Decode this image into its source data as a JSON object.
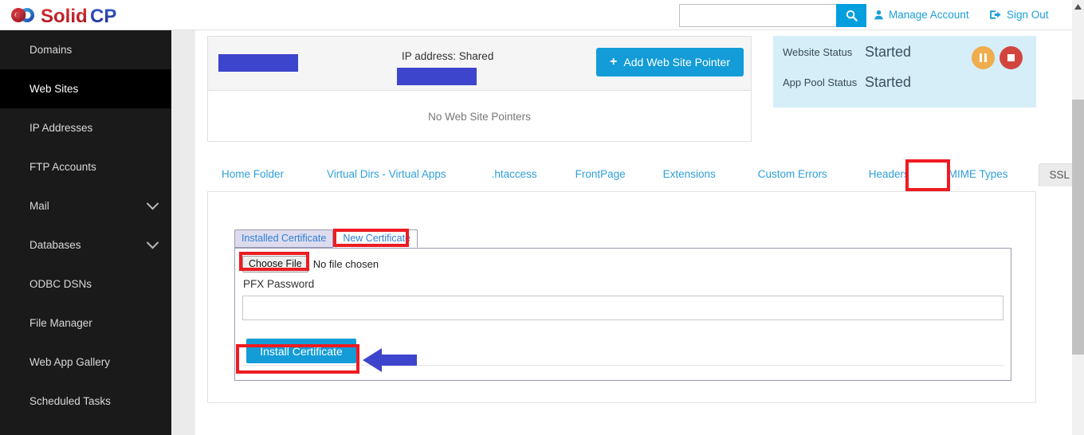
{
  "brand": {
    "name_part1": "Solid",
    "name_part2": "CP",
    "logo_icon": "solidcp-logo-icon",
    "color_red": "#c3161c",
    "color_blue": "#2b3bb5"
  },
  "header": {
    "search": {
      "value": "",
      "placeholder": "",
      "icon": "search-icon"
    },
    "manage_account": {
      "label": "Manage Account",
      "icon": "user-icon"
    },
    "sign_out": {
      "label": "Sign Out",
      "icon": "sign-out-icon"
    }
  },
  "sidebar": {
    "items": [
      {
        "label": "Domains",
        "active": false,
        "chevron": false
      },
      {
        "label": "Web Sites",
        "active": true,
        "chevron": false
      },
      {
        "label": "IP Addresses",
        "active": false,
        "chevron": false
      },
      {
        "label": "FTP Accounts",
        "active": false,
        "chevron": false
      },
      {
        "label": "Mail",
        "active": false,
        "chevron": true
      },
      {
        "label": "Databases",
        "active": false,
        "chevron": true
      },
      {
        "label": "ODBC DSNs",
        "active": false,
        "chevron": false
      },
      {
        "label": "File Manager",
        "active": false,
        "chevron": false
      },
      {
        "label": "Web App Gallery",
        "active": false,
        "chevron": false
      },
      {
        "label": "Scheduled Tasks",
        "active": false,
        "chevron": false
      }
    ]
  },
  "pointer_panel": {
    "domain_redacted": "",
    "ip_label": "IP address: Shared",
    "ip_redacted": "",
    "add_button": "Add Web Site Pointer",
    "add_button_icon": "plus-icon",
    "empty_message": "No Web Site Pointers"
  },
  "status_panel": {
    "website_status_label": "Website Status",
    "website_status_value": "Started",
    "app_pool_status_label": "App Pool Status",
    "app_pool_status_value": "Started",
    "pause_icon": "pause-icon",
    "stop_icon": "stop-icon",
    "pause_color": "#efad4e",
    "stop_color": "#d2453f"
  },
  "tabs": [
    {
      "label": "Home Folder",
      "active": false
    },
    {
      "label": "Virtual Dirs - Virtual Apps",
      "active": false
    },
    {
      "label": ".htaccess",
      "active": false
    },
    {
      "label": "FrontPage",
      "active": false
    },
    {
      "label": "Extensions",
      "active": false
    },
    {
      "label": "Custom Errors",
      "active": false
    },
    {
      "label": "Headers",
      "active": false
    },
    {
      "label": "MIME Types",
      "active": false
    },
    {
      "label": "SSL",
      "active": true
    }
  ],
  "ssl": {
    "cert_tabs": [
      {
        "label": "Installed Certificate",
        "active": true
      },
      {
        "label": "New Certificate",
        "active": false
      }
    ],
    "choose_file_label": "Choose File",
    "file_status": "No file chosen",
    "pfx_password_label": "PFX Password",
    "pfx_password_value": "",
    "pfx_password_placeholder": "",
    "install_button": "Install Certificate"
  },
  "annotations": {
    "highlight_color": "#ee1b22",
    "arrow_color": "#3d45cc",
    "highlighted": [
      "SSL",
      "New Certificate",
      "Choose File",
      "Install Certificate"
    ],
    "arrow_points_to": "Install Certificate"
  },
  "scrollbar": {
    "up_arrow_icon": "scroll-up-icon",
    "thumb_color": "#c1c1c1"
  }
}
